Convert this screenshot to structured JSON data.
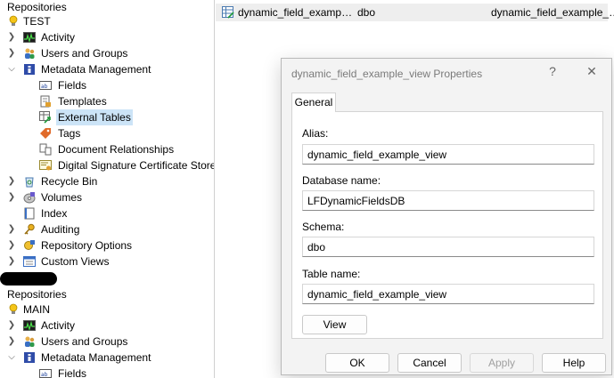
{
  "tree": {
    "top": {
      "header": "Repositories",
      "repo_name": "TEST",
      "items": [
        {
          "label": "Activity"
        },
        {
          "label": "Users and Groups"
        },
        {
          "label": "Metadata Management"
        },
        {
          "label": "Fields"
        },
        {
          "label": "Templates"
        },
        {
          "label": "External Tables"
        },
        {
          "label": "Tags"
        },
        {
          "label": "Document Relationships"
        },
        {
          "label": "Digital Signature Certificate Store"
        },
        {
          "label": "Recycle Bin"
        },
        {
          "label": "Volumes"
        },
        {
          "label": "Index"
        },
        {
          "label": "Auditing"
        },
        {
          "label": "Repository Options"
        },
        {
          "label": "Custom Views"
        }
      ]
    },
    "bottom": {
      "header": "Repositories",
      "repo_name": "MAIN",
      "items": [
        {
          "label": "Activity"
        },
        {
          "label": "Users and Groups"
        },
        {
          "label": "Metadata Management"
        },
        {
          "label": "Fields"
        }
      ]
    }
  },
  "list": {
    "row": {
      "name": "dynamic_field_examp…",
      "schema": "dbo",
      "table": "dynamic_field_example_…"
    }
  },
  "dialog": {
    "title": "dynamic_field_example_view Properties",
    "help_glyph": "?",
    "close_glyph": "✕",
    "tab_label": "General",
    "alias_label": "Alias:",
    "alias_value": "dynamic_field_example_view",
    "database_label": "Database name:",
    "database_value": "LFDynamicFieldsDB",
    "schema_label": "Schema:",
    "schema_value": "dbo",
    "table_label": "Table name:",
    "table_value": "dynamic_field_example_view",
    "view_button": "View",
    "ok_button": "OK",
    "cancel_button": "Cancel",
    "apply_button": "Apply",
    "help_button": "Help"
  }
}
